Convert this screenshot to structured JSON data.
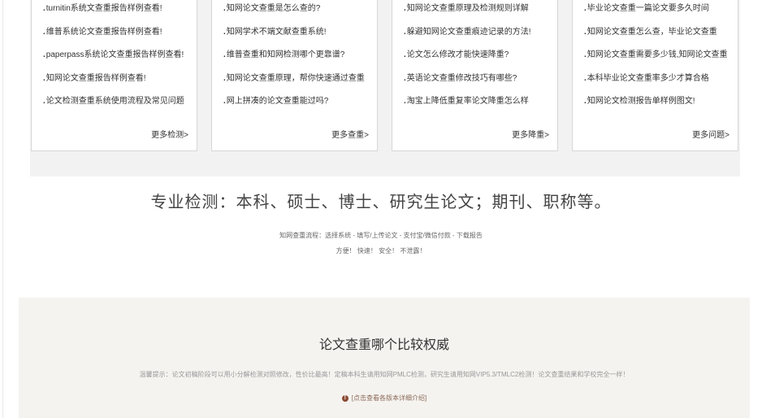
{
  "columns": [
    {
      "items": [
        "turnitin系统文查重报告样例查看!",
        "维普系统论文查重报告样例查看!",
        "paperpass系统论文查重报告样例查看!",
        "知网论文查重报告样例查看!",
        "论文检测查重系统使用流程及常见问题"
      ],
      "more": "更多检测>"
    },
    {
      "items": [
        "知网论文查重是怎么查的?",
        "知网学术不端文献查重系统!",
        "维普查重和知网检测哪个更靠谱?",
        "知网论文查重原理，帮你快速通过查重",
        "网上拼凑的论文查重能过吗?"
      ],
      "more": "更多查重>"
    },
    {
      "items": [
        "知网论文查重原理及检测规则详解",
        "躲避知网论文查重痕迹记录的方法!",
        "论文怎么修改才能快速降重?",
        "英语论文查重修改技巧有哪些?",
        "淘宝上降低重复率论文降重怎么样"
      ],
      "more": "更多降重>"
    },
    {
      "items": [
        "毕业论文查重一篇论文要多久时间",
        "知网论文查重怎么查，毕业论文查重",
        "知网论文查重需要多少钱,知网论文查重",
        "本科毕业论文查重率多少才算合格",
        "知网论文检测报告单样例图文!"
      ],
      "more": "更多问题>"
    }
  ],
  "headline": "专业检测：本科、硕士、博士、研究生论文；期刊、职称等。",
  "flow": "知网查重流程：选择系统 - 填写/上传论文 - 支付宝/微信付款 - 下载报告",
  "slogan": "方便！ 快速！ 安全！ 不泄露！",
  "panel": {
    "title": "论文查重哪个比较权威",
    "tip": "温馨提示：论文初稿阶段可以用小分解检测对照修改，性价比最高！定稿本科生请用知网PMLC检测，研究生请用知网VIP5.3/TMLC2检测！论文查重结果和学校完全一样！",
    "link": "[点击查看各版本详细介绍]",
    "icon": "info-icon"
  }
}
